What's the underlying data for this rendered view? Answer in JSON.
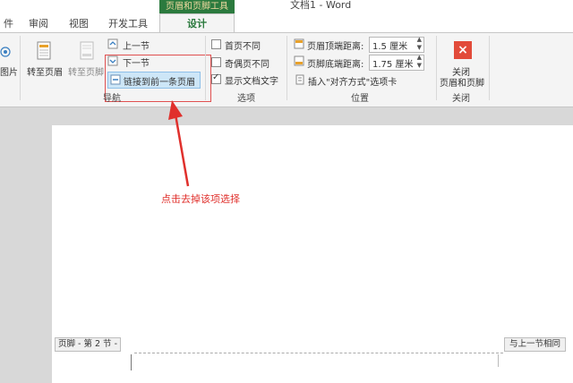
{
  "window": {
    "title": "文档1 - Word"
  },
  "context_tab": {
    "label": "页眉和页脚工具"
  },
  "tabs": [
    {
      "label": "件"
    },
    {
      "label": "审阅"
    },
    {
      "label": "视图"
    },
    {
      "label": "开发工具"
    },
    {
      "label": "设计"
    }
  ],
  "ribbon": {
    "insert": {
      "picture_label": "图片"
    },
    "navigation": {
      "goto_header": "转至页眉",
      "goto_footer": "转至页脚",
      "prev_section": "上一节",
      "next_section": "下一节",
      "link_previous": "链接到前一条页眉",
      "group_label": "导航"
    },
    "options": {
      "different_first": "首页不同",
      "different_odd_even": "奇偶页不同",
      "show_doc_text": "显示文档文字",
      "group_label": "选项",
      "show_doc_text_checked": true
    },
    "position": {
      "header_top_label": "页眉顶端距离:",
      "header_top_value": "1.5 厘米",
      "footer_bottom_label": "页脚底端距离:",
      "footer_bottom_value": "1.75 厘米",
      "insert_align_tab": "插入\"对齐方式\"选项卡",
      "group_label": "位置"
    },
    "close": {
      "button_line1": "关闭",
      "button_line2": "页眉和页脚",
      "group_label": "关闭"
    }
  },
  "document": {
    "footer_label": "页脚 - 第 2 节 -",
    "same_as_previous": "与上一节相同"
  },
  "annotation": {
    "text": "点击去掉该项选择",
    "color": "#e0302c"
  },
  "colors": {
    "context_green": "#2b7a3e",
    "close_red": "#e24b3a"
  }
}
